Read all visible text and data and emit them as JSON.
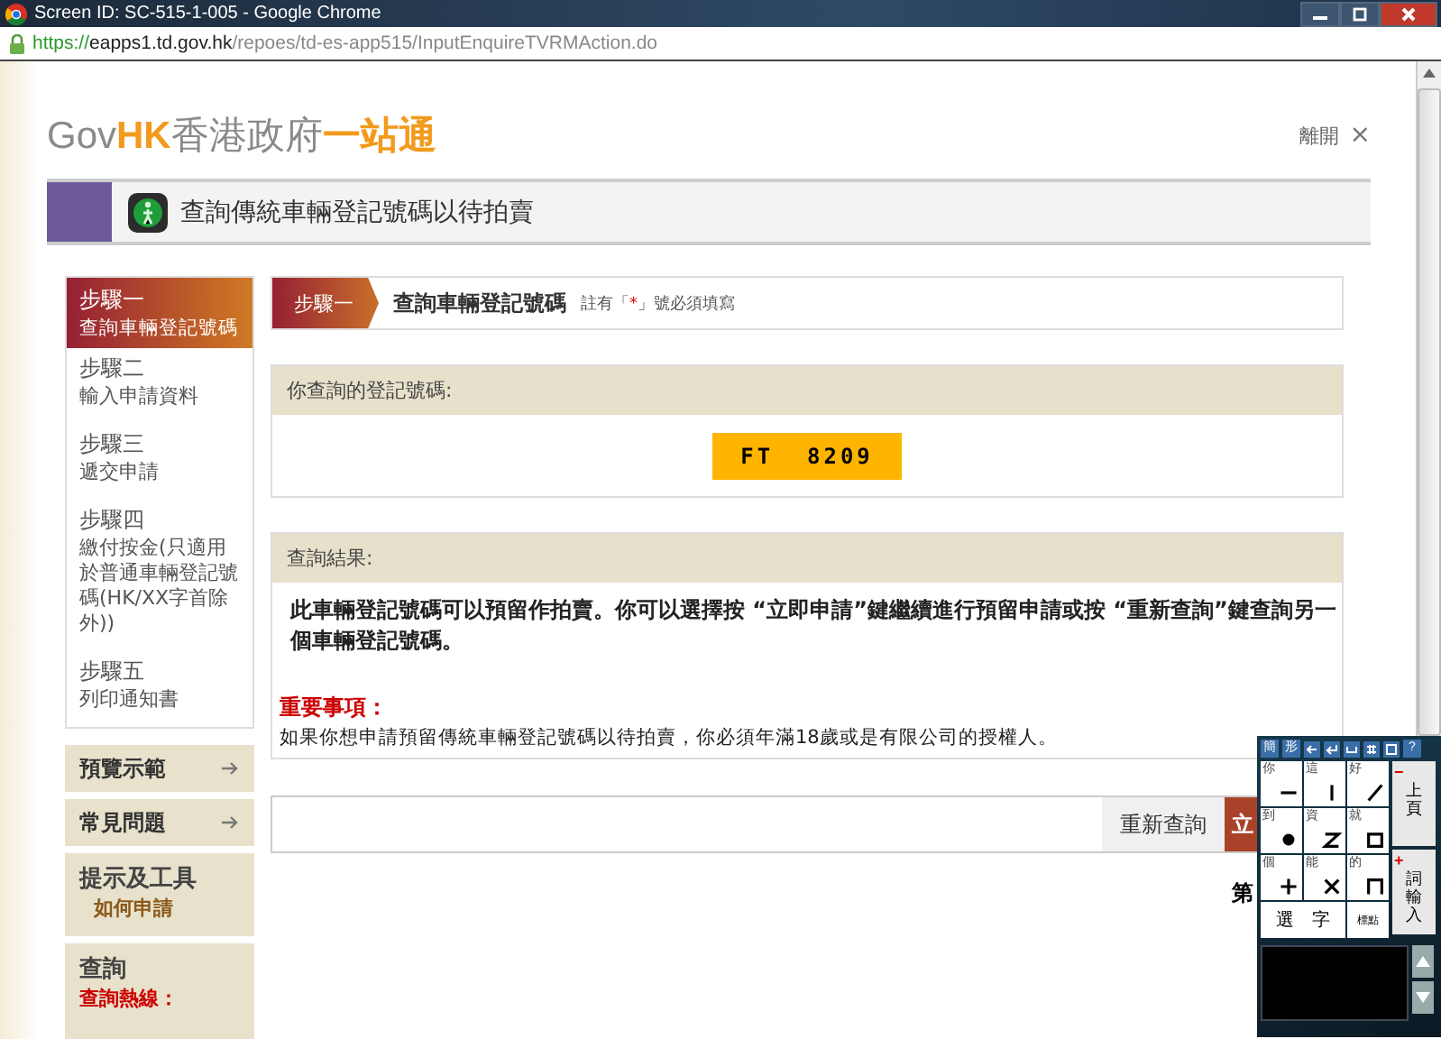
{
  "window": {
    "title": "Screen ID: SC-515-1-005 - Google Chrome"
  },
  "address_bar": {
    "scheme": "https://",
    "host": "eapps1.td.gov.hk",
    "path": "/repoes/td-es-app515/InputEnquireTVRMAction.do"
  },
  "header": {
    "logo": {
      "gov": "Gov",
      "hk": "HK",
      "name": "香港政府",
      "tagline": "一站通"
    },
    "exit_link": "離開",
    "exit_mark": "×"
  },
  "page_title": "查詢傳統車輛登記號碼以待拍賣",
  "steps": [
    {
      "step": "步驟一",
      "label": "查詢車輛登記號碼",
      "selected": true
    },
    {
      "step": "步驟二",
      "label": "輸入申請資料",
      "selected": false
    },
    {
      "step": "步驟三",
      "label": "遞交申請",
      "selected": false
    },
    {
      "step": "步驟四",
      "label": "繳付按金(只適用於普通車輛登記號碼(HK/XX字首除外))",
      "selected": false
    },
    {
      "step": "步驟五",
      "label": "列印通知書",
      "selected": false
    }
  ],
  "side_links": [
    {
      "label": "預覽示範"
    },
    {
      "label": "常見問題"
    }
  ],
  "tools": {
    "title": "提示及工具",
    "link": "如何申請"
  },
  "enquiry": {
    "title": "查詢",
    "hotline": "查詢熱線："
  },
  "step_banner": {
    "step": "步驟一",
    "title": "查詢車輛登記號碼",
    "note_prefix": "註有「",
    "required_mark": "*",
    "note_suffix": "」號必須填寫"
  },
  "plate_section": {
    "heading": "你查詢的登記號碼:",
    "plate": "FT  8209"
  },
  "result_section": {
    "heading": "查詢結果:",
    "message": "此車輛登記號碼可以預留作拍賣。你可以選擇按 “立即申請”鍵繼續進行預留申請或按 “重新查詢”鍵查詢另一個車輛登記號碼。",
    "important_heading": "重要事項：",
    "important_text": "如果你想申請預留傳統車輛登記號碼以待拍賣，你必須年滿18歲或是有限公司的授權人。"
  },
  "actions": [
    {
      "label": "重新查詢",
      "kind": "secondary"
    },
    {
      "label": "立",
      "kind": "primary"
    }
  ],
  "page_indicator": "第",
  "ime": {
    "toolbar": [
      "簡",
      "形",
      "?"
    ],
    "cells": [
      {
        "char": "你",
        "kind": "horizontal"
      },
      {
        "char": "這",
        "kind": "vertical"
      },
      {
        "char": "好",
        "kind": "slash"
      },
      {
        "char": "到",
        "kind": "dot"
      },
      {
        "char": "資",
        "kind": "zigzag"
      },
      {
        "char": "就",
        "kind": "box"
      },
      {
        "char": "個",
        "kind": "plus"
      },
      {
        "char": "能",
        "kind": "cross"
      },
      {
        "char": "的",
        "kind": "hook"
      }
    ],
    "select_button": "選　字",
    "punct_button": "標點",
    "side_buttons": [
      {
        "sign": "−",
        "label": "上頁"
      },
      {
        "sign": "+",
        "label": "詞輸入"
      }
    ]
  }
}
